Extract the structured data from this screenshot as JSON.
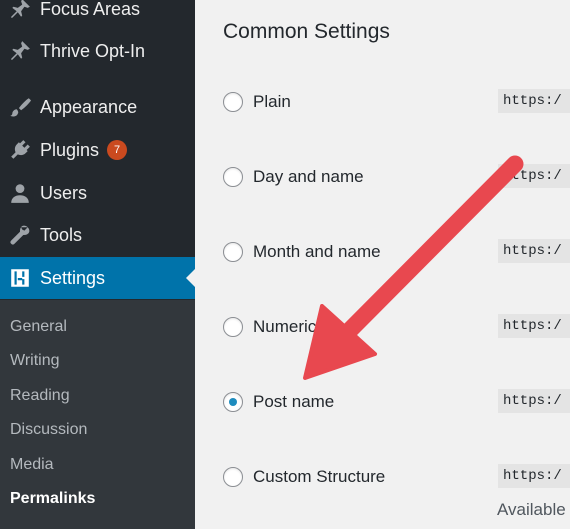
{
  "sidebar": {
    "items": [
      {
        "label": "Focus Areas",
        "icon": "pin-icon"
      },
      {
        "label": "Thrive Opt-In",
        "icon": "pin-icon"
      },
      {
        "label": "Appearance",
        "icon": "paintbrush-icon"
      },
      {
        "label": "Plugins",
        "icon": "plugin-icon",
        "badge": "7"
      },
      {
        "label": "Users",
        "icon": "user-icon"
      },
      {
        "label": "Tools",
        "icon": "wrench-icon"
      },
      {
        "label": "Settings",
        "icon": "settings-icon",
        "active": true
      }
    ],
    "submenu": [
      {
        "label": "General"
      },
      {
        "label": "Writing"
      },
      {
        "label": "Reading"
      },
      {
        "label": "Discussion"
      },
      {
        "label": "Media"
      },
      {
        "label": "Permalinks",
        "current": true
      }
    ]
  },
  "main": {
    "heading": "Common Settings",
    "options": [
      {
        "label": "Plain",
        "code": "https:/",
        "checked": false
      },
      {
        "label": "Day and name",
        "code": "https:/",
        "checked": false
      },
      {
        "label": "Month and name",
        "code": "https:/",
        "checked": false
      },
      {
        "label": "Numeric",
        "code": "https:/",
        "checked": false
      },
      {
        "label": "Post name",
        "code": "https:/",
        "checked": true
      },
      {
        "label": "Custom Structure",
        "code": "https:/",
        "checked": false
      }
    ],
    "available": "Available"
  },
  "colors": {
    "sidebar_bg": "#23282d",
    "submenu_bg": "#32373c",
    "active_bg": "#0073aa",
    "badge": "#ca4a1f",
    "arrow": "#e8484f"
  }
}
